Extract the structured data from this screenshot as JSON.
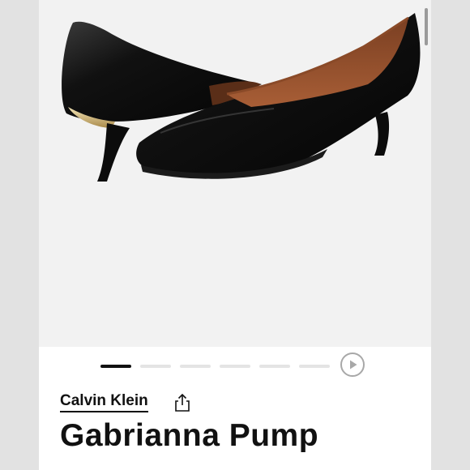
{
  "product": {
    "brand": "Calvin Klein",
    "name": "Gabrianna Pump",
    "image_alt": "black leather kitten heel pump"
  },
  "gallery": {
    "slide_count": 6,
    "active_index": 0
  },
  "icons": {
    "share": "share-icon",
    "play": "play-icon"
  },
  "colors": {
    "text": "#111111",
    "inactive_dash": "#e4e4e4",
    "image_bg": "#f2f2f2"
  }
}
